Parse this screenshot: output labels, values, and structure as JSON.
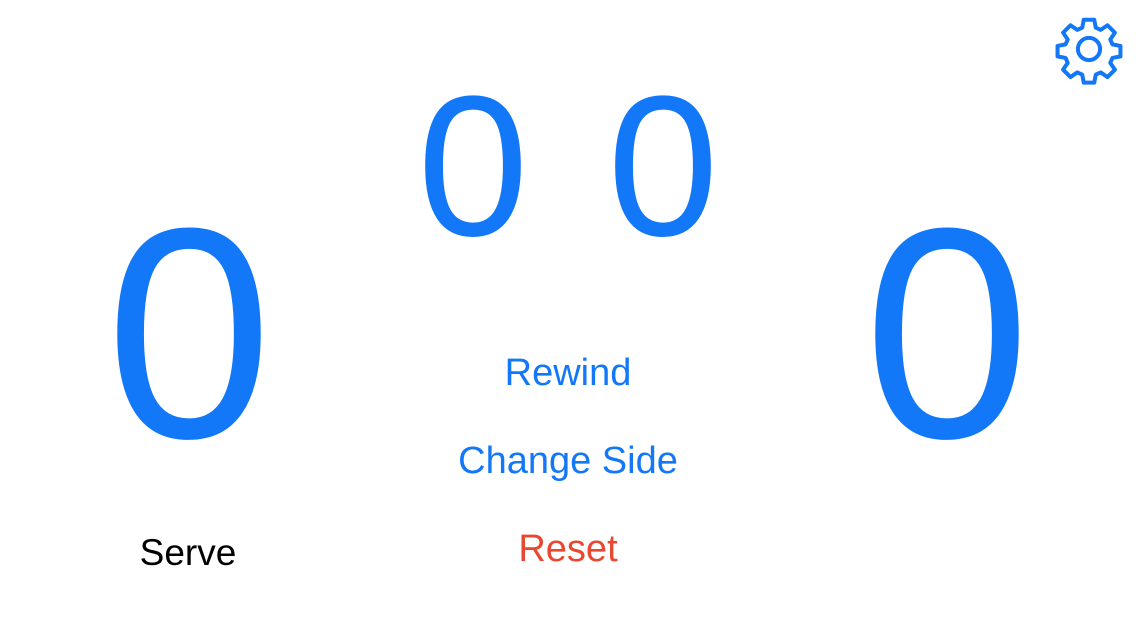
{
  "scores": {
    "left_points": "0",
    "right_points": "0",
    "left_sets": "0",
    "right_sets": "0"
  },
  "controls": {
    "rewind_label": "Rewind",
    "change_side_label": "Change Side",
    "reset_label": "Reset"
  },
  "serve_label": "Serve",
  "settings_icon": "gear-icon",
  "colors": {
    "accent": "#1378f7",
    "destructive": "#e9472f",
    "text": "#000000",
    "background": "#ffffff"
  }
}
